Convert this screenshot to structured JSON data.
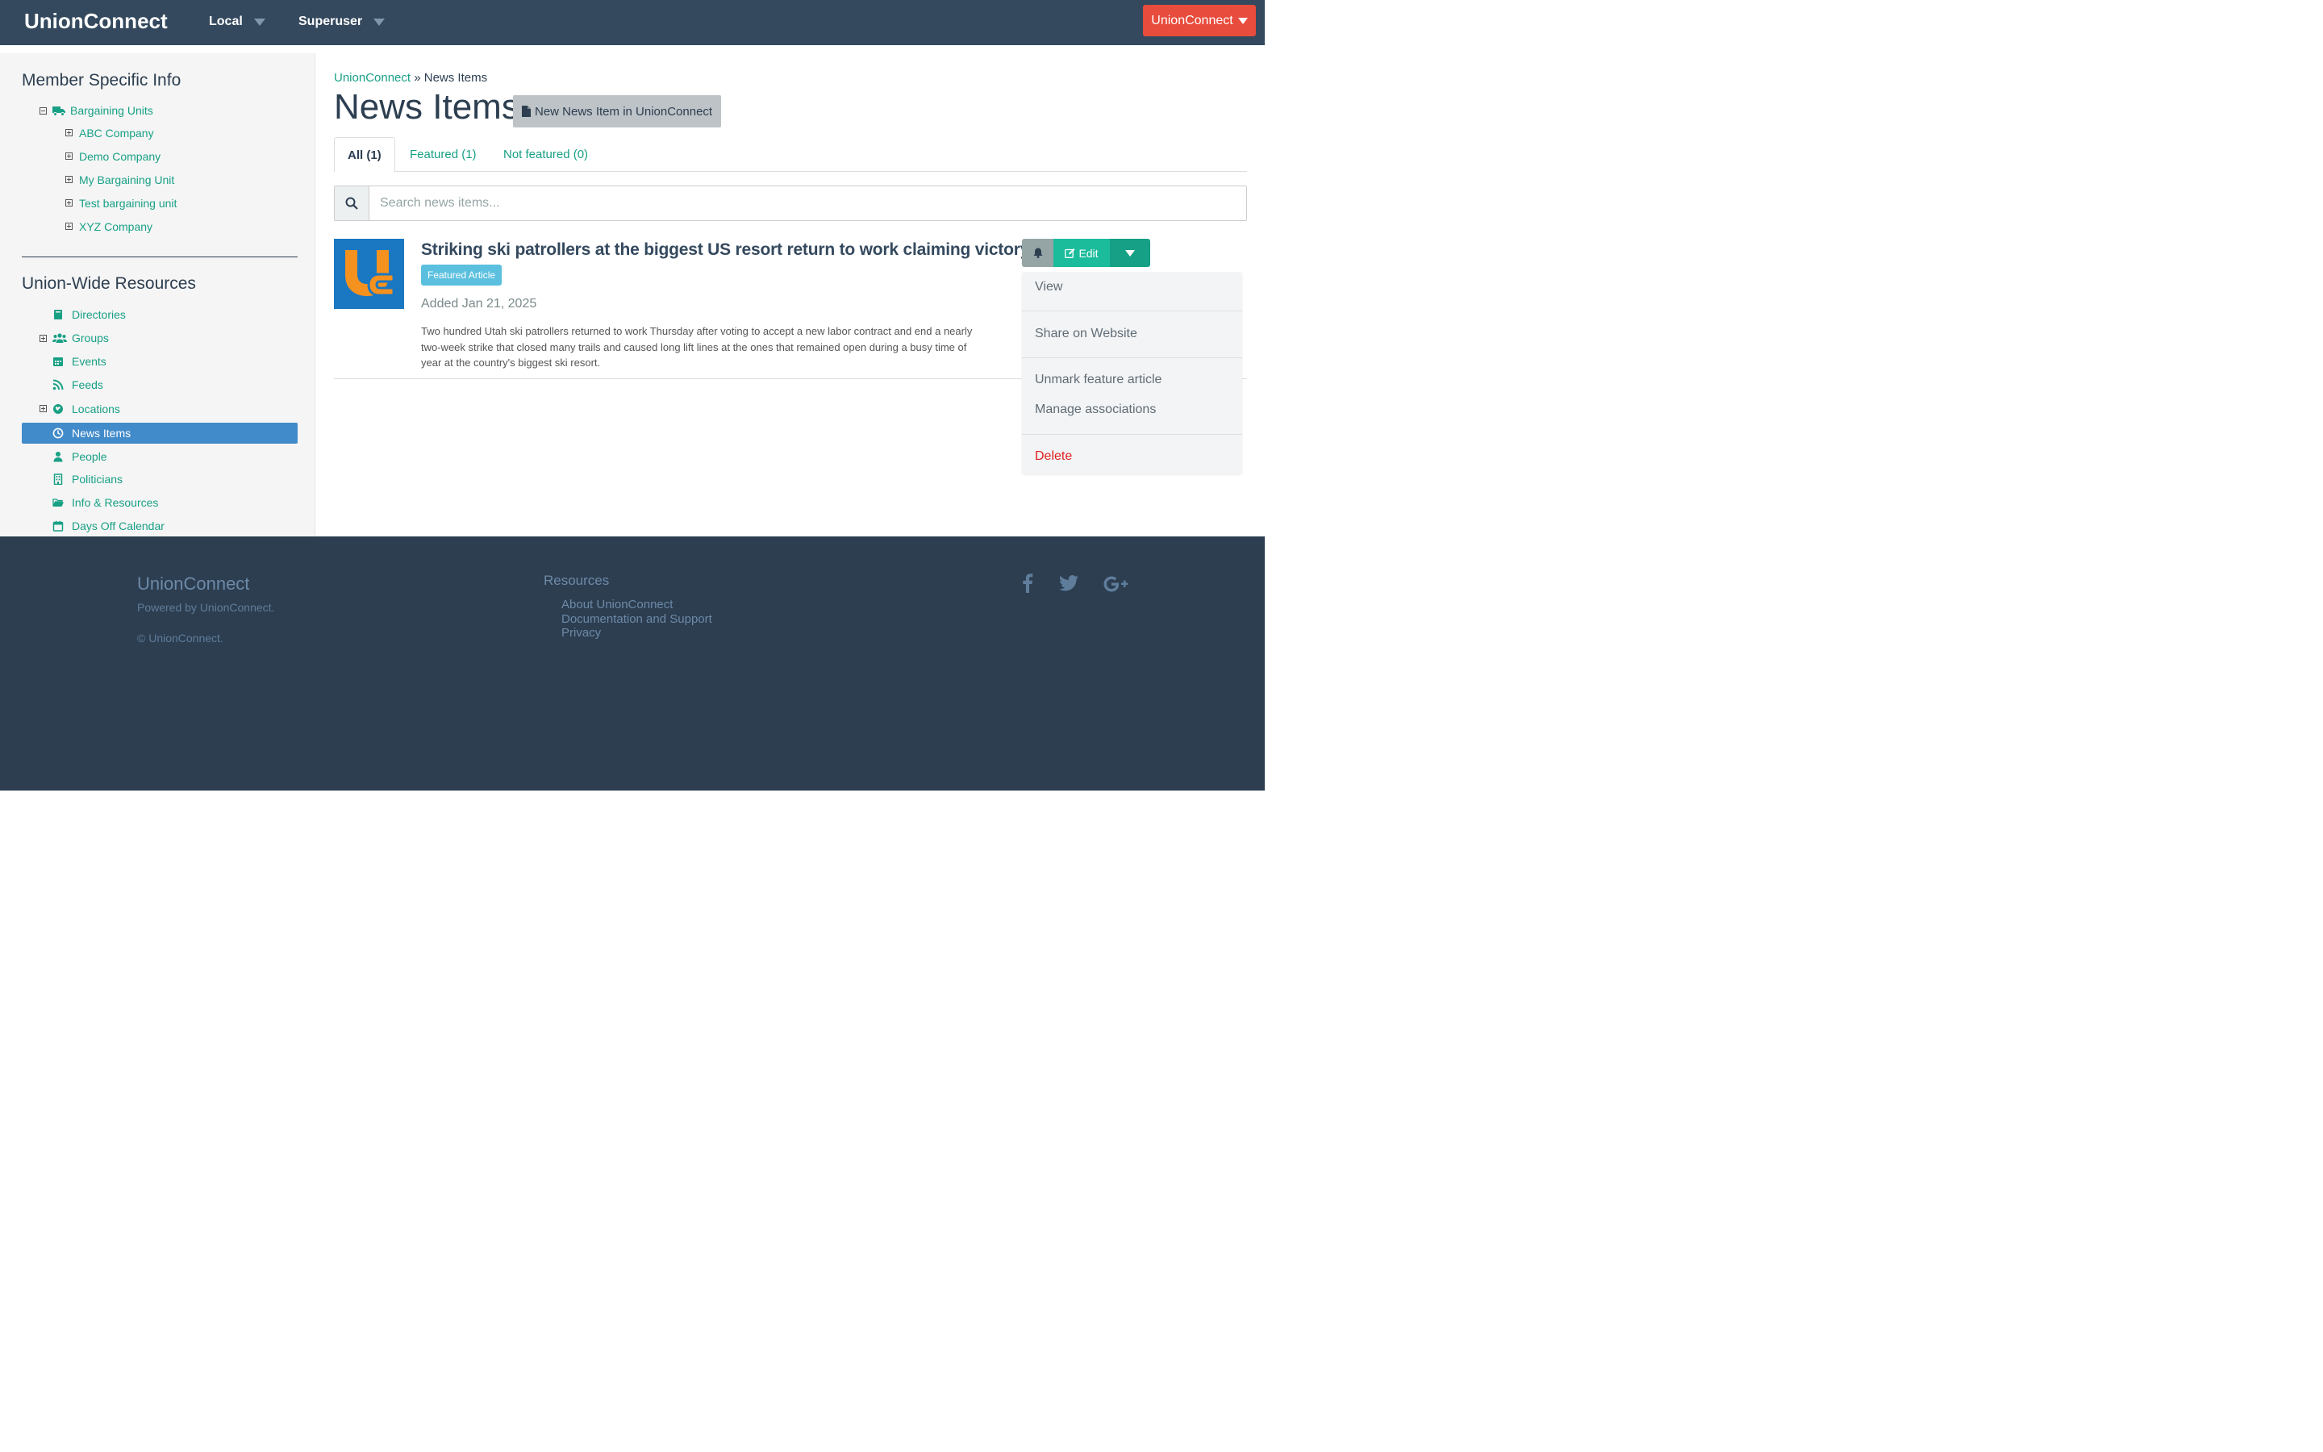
{
  "navbar": {
    "brand": "UnionConnect",
    "menus": [
      {
        "label": "Local"
      },
      {
        "label": "Superuser"
      }
    ],
    "org_button": "UnionConnect",
    "colors": {
      "bar": "#34495e",
      "org_button": "#e74c3c"
    }
  },
  "sidebar": {
    "member_heading": "Member Specific Info",
    "bargaining_units": {
      "label": "Bargaining Units",
      "icon": "truck-icon",
      "children": [
        "ABC Company",
        "Demo Company",
        "My Bargaining Unit",
        "Test bargaining unit",
        "XYZ Company"
      ]
    },
    "resources_heading": "Union-Wide Resources",
    "resources": [
      {
        "label": "Directories",
        "icon": "book-icon",
        "expandable": false
      },
      {
        "label": "Groups",
        "icon": "users-icon",
        "expandable": true
      },
      {
        "label": "Events",
        "icon": "calendar-icon",
        "expandable": false
      },
      {
        "label": "Feeds",
        "icon": "rss-icon",
        "expandable": false
      },
      {
        "label": "Locations",
        "icon": "globe-icon",
        "expandable": true
      },
      {
        "label": "News Items",
        "icon": "clock-icon",
        "expandable": false,
        "active": true
      },
      {
        "label": "People",
        "icon": "user-icon",
        "expandable": false
      },
      {
        "label": "Politicians",
        "icon": "building-icon",
        "expandable": false
      },
      {
        "label": "Info & Resources",
        "icon": "folder-open-icon",
        "expandable": false
      },
      {
        "label": "Days Off Calendar",
        "icon": "calendar-o-icon",
        "expandable": false
      }
    ],
    "colors": {
      "link": "#18a085",
      "active": "#428bca"
    }
  },
  "main": {
    "breadcrumb": {
      "root": "UnionConnect",
      "separator": "»",
      "current": "News Items"
    },
    "title": "News Items",
    "new_button": "New News Item in UnionConnect",
    "tabs": [
      {
        "label": "All (1)",
        "active": true
      },
      {
        "label": "Featured (1)",
        "active": false
      },
      {
        "label": "Not featured (0)",
        "active": false
      }
    ],
    "search": {
      "placeholder": "Search news items...",
      "value": ""
    },
    "item": {
      "title": "Striking ski patrollers at the biggest US resort return to work claiming victory",
      "badge": "Featured Article",
      "added": "Added Jan 21, 2025",
      "summary": "Two hundred Utah ski patrollers returned to work Thursday after voting to accept a new labor contract and end a nearly two-week strike that closed many trails and caused long lift lines at the ones that remained open during a busy time of year at the country's biggest ski resort.",
      "thumbnail": "unionconnect-logo-icon",
      "actions": {
        "edit": "Edit",
        "bell": "bell-icon"
      }
    },
    "dropdown": [
      "View",
      "Share on Website",
      "Unmark feature article",
      "Manage associations",
      "Delete"
    ]
  },
  "footer": {
    "brand": "UnionConnect",
    "powered": "Powered by UnionConnect.",
    "copyright": "© UnionConnect.",
    "resources_heading": "Resources",
    "links": [
      "About UnionConnect",
      "Documentation and Support",
      "Privacy"
    ],
    "social": [
      "facebook-icon",
      "twitter-icon",
      "google-plus-icon"
    ]
  }
}
